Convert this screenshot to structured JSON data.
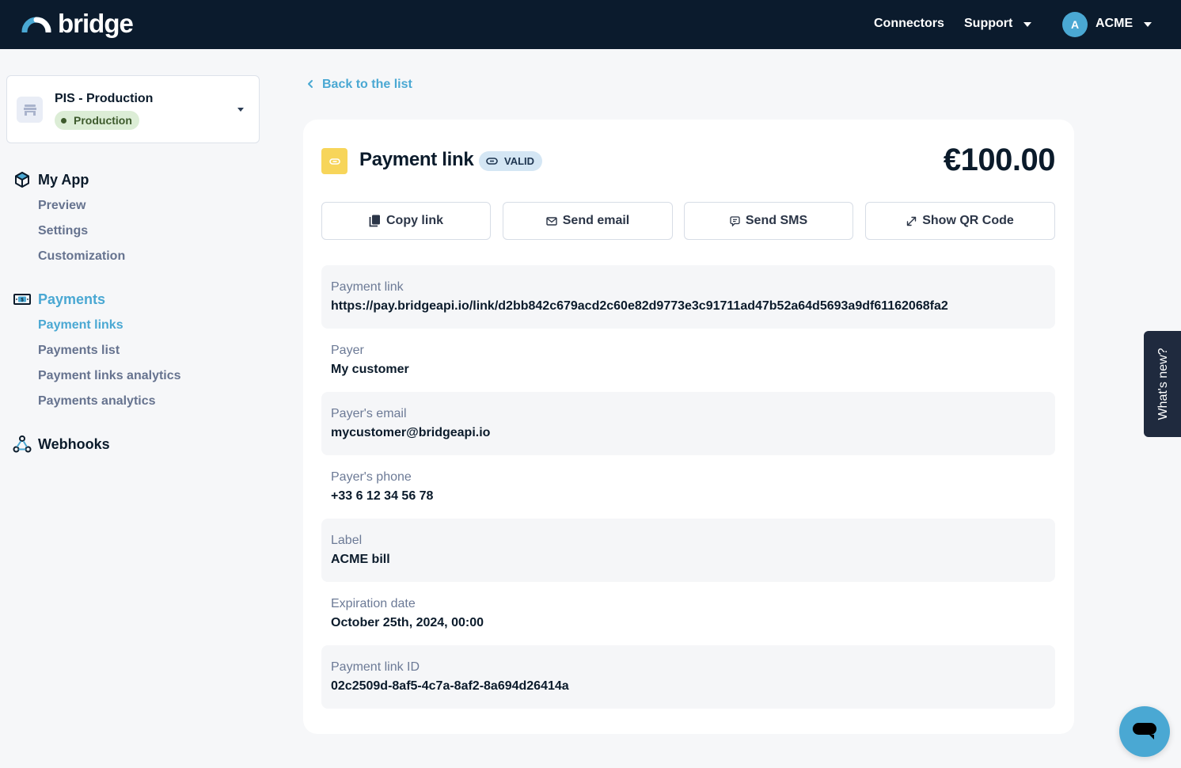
{
  "topbar": {
    "logo_text": "bridge",
    "nav": {
      "connectors": "Connectors",
      "support": "Support",
      "account_initial": "A",
      "account_name": "ACME"
    }
  },
  "sidebar": {
    "environment": {
      "title": "PIS - Production",
      "badge": "Production",
      "badge_color": "#3d5a2c"
    },
    "sections": [
      {
        "label": "My App",
        "icon": "cube-icon",
        "items": [
          {
            "label": "Preview"
          },
          {
            "label": "Settings"
          },
          {
            "label": "Customization"
          }
        ]
      },
      {
        "label": "Payments",
        "icon": "banknote-icon",
        "active": true,
        "items": [
          {
            "label": "Payment links",
            "active": true
          },
          {
            "label": "Payments list"
          },
          {
            "label": "Payment links analytics"
          },
          {
            "label": "Payments analytics"
          }
        ]
      },
      {
        "label": "Webhooks",
        "icon": "webhook-icon",
        "items": []
      }
    ]
  },
  "main": {
    "back_label": "Back to the list",
    "title": "Payment link",
    "status": "VALID",
    "amount": "€100.00",
    "actions": {
      "copy": "Copy link",
      "email": "Send email",
      "sms": "Send SMS",
      "qr": "Show QR Code"
    },
    "fields": [
      {
        "label": "Payment link",
        "value": "https://pay.bridgeapi.io/link/d2bb842c679acd2c60e82d9773e3c91711ad47b52a64d5693a9df61162068fa2"
      },
      {
        "label": "Payer",
        "value": "My customer"
      },
      {
        "label": "Payer's email",
        "value": "mycustomer@bridgeapi.io"
      },
      {
        "label": "Payer's phone",
        "value": "+33 6 12 34 56 78"
      },
      {
        "label": "Label",
        "value": "ACME bill"
      },
      {
        "label": "Expiration date",
        "value": "October 25th, 2024, 00:00"
      },
      {
        "label": "Payment link ID",
        "value": "02c2509d-8af5-4c7a-8af2-8a694d26414a"
      }
    ]
  },
  "widgets": {
    "whats_new": "What's new?"
  },
  "colors": {
    "brand": "#4aa8d3",
    "topbar": "#0b1b2d",
    "accent_yellow": "#f7d55a"
  }
}
